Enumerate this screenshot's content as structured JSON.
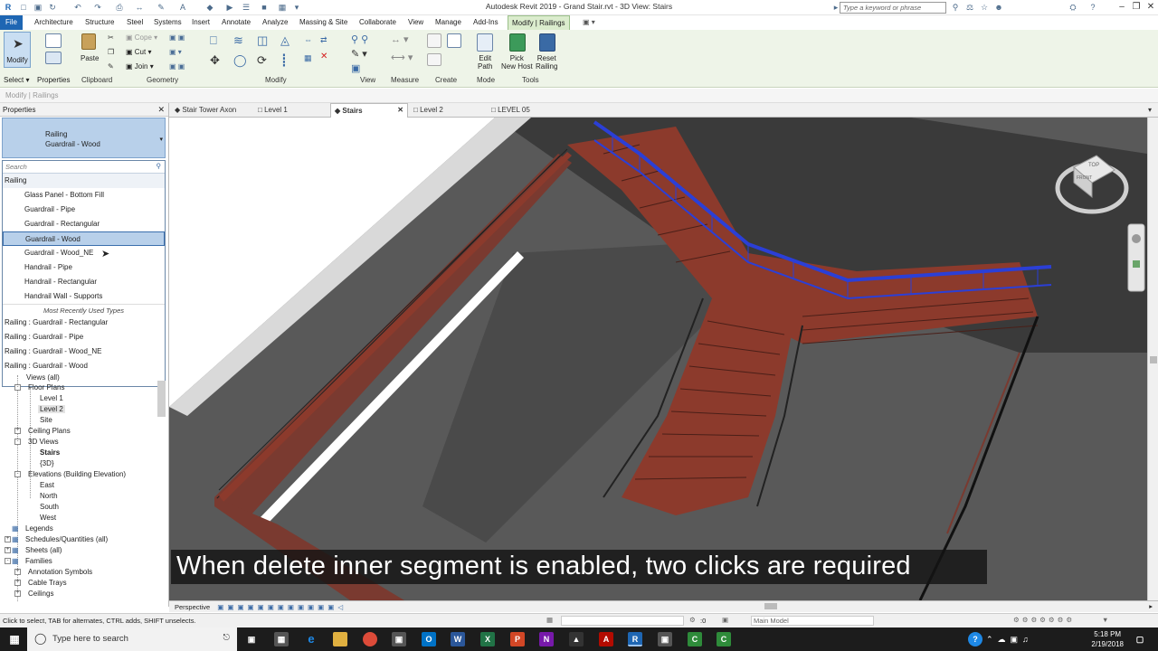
{
  "app": {
    "title": "Autodesk Revit 2019 - Grand Stair.rvt - 3D View: Stairs",
    "search_placeholder": "Type a keyword or phrase"
  },
  "menu": {
    "tabs": [
      "File",
      "Architecture",
      "Structure",
      "Steel",
      "Systems",
      "Insert",
      "Annotate",
      "Analyze",
      "Massing & Site",
      "Collaborate",
      "View",
      "Manage",
      "Add-Ins",
      "Modify | Railings"
    ]
  },
  "ribbon": {
    "modify_label": "Modify",
    "select_label": "Select",
    "properties_label": "Properties",
    "paste_label": "Paste",
    "cope_label": "Cope",
    "cut_label": "Cut",
    "join_label": "Join",
    "clipboard_label": "Clipboard",
    "geometry_label": "Geometry",
    "modify_panel_label": "Modify",
    "view_label": "View",
    "measure_label": "Measure",
    "create_label": "Create",
    "mode_label": "Mode",
    "tools_label": "Tools",
    "edit_path_label1": "Edit",
    "edit_path_label2": "Path",
    "pick_host_label1": "Pick",
    "pick_host_label2": "New Host",
    "reset_label1": "Reset",
    "reset_label2": "Railing"
  },
  "context_bar": "Modify | Railings",
  "properties": {
    "header": "Properties",
    "type_family": "Railing",
    "type_name": "Guardrail - Wood",
    "search_placeholder": "Search",
    "group": "Railing",
    "items": [
      "Glass Panel - Bottom Fill",
      "Guardrail - Pipe",
      "Guardrail - Rectangular",
      "Guardrail - Wood",
      "Guardrail - Wood_NE",
      "Handrail - Pipe",
      "Handrail - Rectangular",
      "Handrail Wall - Supports"
    ],
    "mru_label": "Most Recently Used Types",
    "recent": [
      "Railing : Guardrail - Rectangular",
      "Railing : Guardrail - Pipe",
      "Railing : Guardrail - Wood_NE",
      "Railing : Guardrail - Wood"
    ]
  },
  "browser": {
    "views_all": "Views (all)",
    "floor_plans": "Floor Plans",
    "level1": "Level 1",
    "level2": "Level 2",
    "site": "Site",
    "ceiling_plans": "Ceiling Plans",
    "views3d": "3D Views",
    "stairs": "Stairs",
    "v3d": "{3D}",
    "elevations": "Elevations (Building Elevation)",
    "east": "East",
    "north": "North",
    "south": "South",
    "west": "West",
    "legends": "Legends",
    "schedules": "Schedules/Quantities (all)",
    "sheets": "Sheets (all)",
    "families": "Families",
    "annotation": "Annotation Symbols",
    "cable_trays": "Cable Trays",
    "ceilings": "Ceilings"
  },
  "view_tabs": [
    "Stair Tower Axon",
    "Level 1",
    "Stairs",
    "Level 2",
    "LEVEL 05"
  ],
  "viewcube": {
    "top": "TOP",
    "front": "FRONT"
  },
  "caption": "When delete inner segment is enabled, two clicks are required",
  "view_control": {
    "mode": "Perspective"
  },
  "status": {
    "hint": "Click to select, TAB for alternates, CTRL adds, SHIFT unselects.",
    "selection_count": ":0",
    "model": "Main Model"
  },
  "taskbar": {
    "search_placeholder": "Type here to search",
    "time": "5:18 PM",
    "date": "2/19/2018"
  },
  "colors": {
    "selected_railing": "#2b3fd6",
    "stair_wood": "#8c3a2c",
    "ribbon_bg": "#eef4e8",
    "file_tab": "#1e66b3"
  }
}
